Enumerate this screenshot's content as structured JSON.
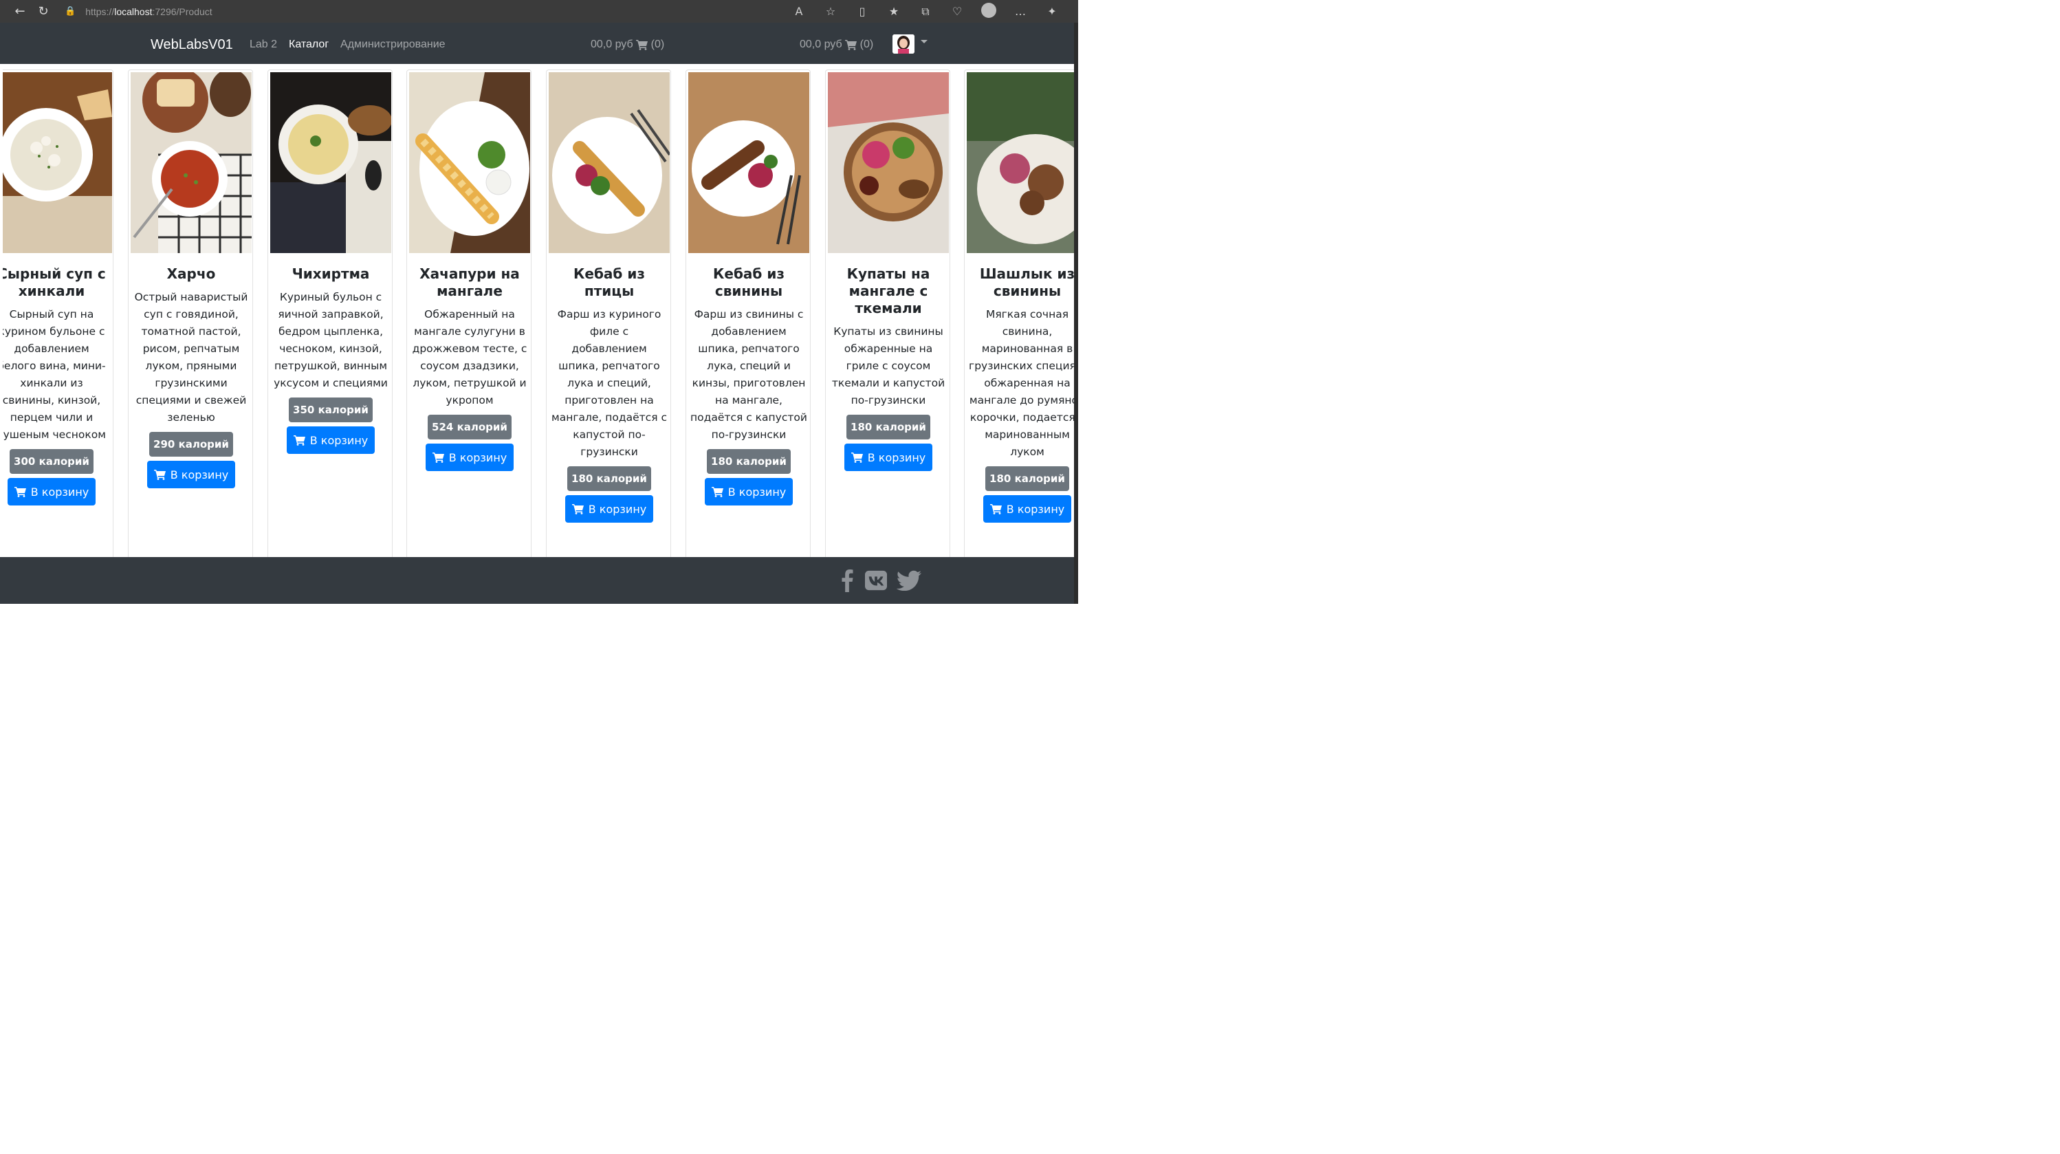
{
  "browser": {
    "url_scheme": "https://",
    "url_host": "localhost",
    "url_rest": ":7296/Product"
  },
  "navbar": {
    "brand": "WebLabsV01",
    "links": [
      "Lab 2",
      "Каталог",
      "Администрирование"
    ],
    "active_link": "Каталог",
    "cart_center": "00,0 руб",
    "cart_center_count": "(0)",
    "cart_right": "00,0 руб",
    "cart_right_count": "(0)"
  },
  "products": [
    {
      "title": "Сырный суп с хинкали",
      "description": "Сырный суп на курином бульоне с добавлением белого вина, мини- хинкали из свинины, кинзой, перцем чили и сушеным чесноком",
      "calories": "300 калорий",
      "button": "В корзину"
    },
    {
      "title": "Харчо",
      "description": "Острый наваристый суп с говядиной, томатной пастой, рисом, репчатым луком, пряными грузинскими специями и свежей зеленью",
      "calories": "290 калорий",
      "button": "В корзину"
    },
    {
      "title": "Чихиртма",
      "description": "Куриный бульон с яичной заправкой, бедром цыпленка, чесноком, кинзой, петрушкой, винным уксусом и специями",
      "calories": "350 калорий",
      "button": "В корзину"
    },
    {
      "title": "Хачапури на мангале",
      "description": "Обжаренный на мангале сулугуни в дрожжевом тесте, с соусом дзадзики, луком, петрушкой и укропом",
      "calories": "524 калорий",
      "button": "В корзину"
    },
    {
      "title": "Кебаб из птицы",
      "description": "Фарш из куриного филе с добавлением шпика, репчатого лука и специй, приготовлен на мангале, подаётся с капустой по-грузински",
      "calories": "180 калорий",
      "button": "В корзину"
    },
    {
      "title": "Кебаб из свинины",
      "description": "Фарш из свинины с добавлением шпика, репчатого лука, специй и кинзы, приготовлен на мангале, подаётся с капустой по-грузински",
      "calories": "180 калорий",
      "button": "В корзину"
    },
    {
      "title": "Купаты на мангале с ткемали",
      "description": "Купаты из свинины обжаренные на гриле с соусом ткемали и капустой по-грузински",
      "calories": "180 калорий",
      "button": "В корзину"
    },
    {
      "title": "Шашлык из свинины",
      "description": "Мягкая сочная свинина, маринованная в грузинских специях, обжаренная на мангале до румяной корочки, подается с маринованным луком",
      "calories": "180 калорий",
      "button": "В корзину"
    }
  ],
  "footer": {
    "social_icons": [
      "facebook-icon",
      "vk-icon",
      "twitter-icon"
    ]
  },
  "colors": {
    "navbar_bg": "#343a40",
    "primary": "#007bff",
    "badge": "#6c757d"
  }
}
